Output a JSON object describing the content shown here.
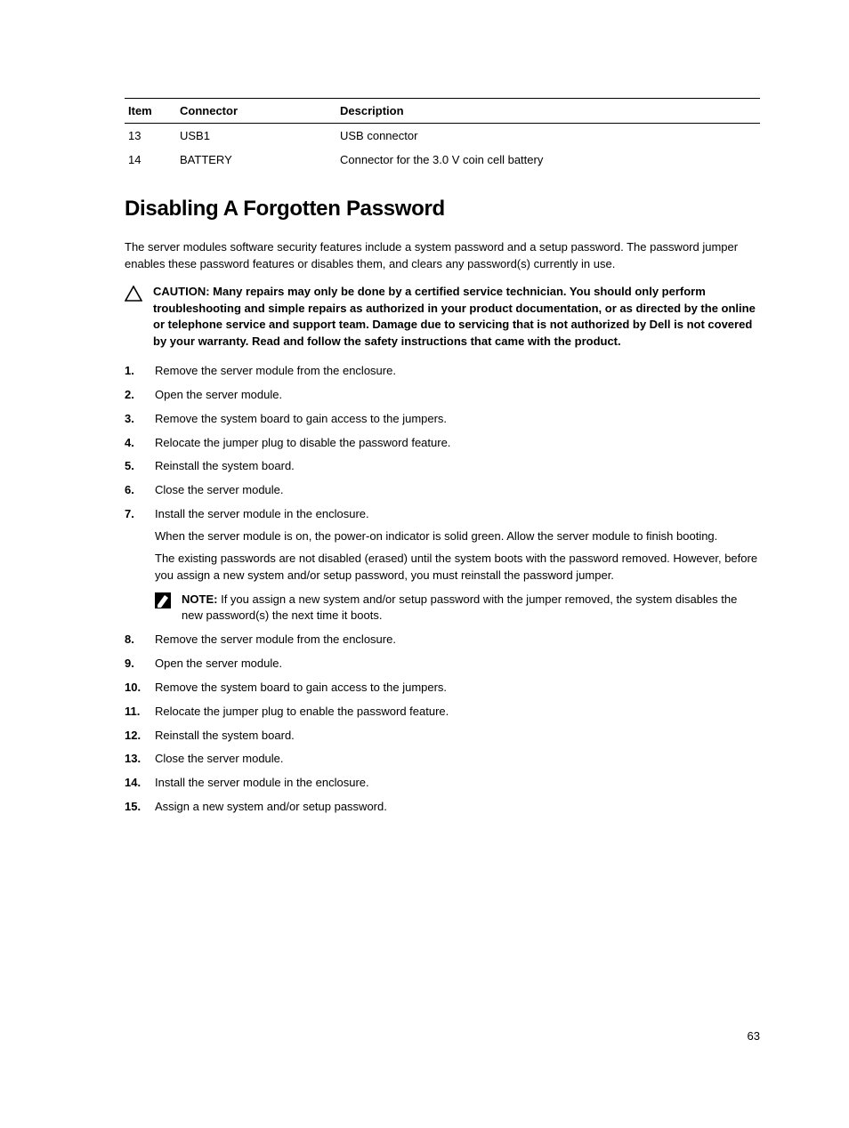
{
  "table": {
    "headers": {
      "item": "Item",
      "connector": "Connector",
      "description": "Description"
    },
    "rows": [
      {
        "item": "13",
        "connector": "USB1",
        "description": "USB connector"
      },
      {
        "item": "14",
        "connector": "BATTERY",
        "description": "Connector for the 3.0 V coin cell battery"
      }
    ]
  },
  "section_title": "Disabling A Forgotten Password",
  "intro": "The server modules software security features include a system password and a setup password. The password jumper enables these password features or disables them, and clears any password(s) currently in use.",
  "caution": {
    "label": "CAUTION:",
    "text": "Many repairs may only be done by a certified service technician. You should only perform troubleshooting and simple repairs as authorized in your product documentation, or as directed by the online or telephone service and support team. Damage due to servicing that is not authorized by Dell is not covered by your warranty. Read and follow the safety instructions that came with the product."
  },
  "steps": {
    "s1": "Remove the server module from the enclosure.",
    "s2": "Open the server module.",
    "s3": "Remove the system board to gain access to the jumpers.",
    "s4": "Relocate the jumper plug to disable the password feature.",
    "s5": "Reinstall the system board.",
    "s6": "Close the server module.",
    "s7": "Install the server module in the enclosure.",
    "s7p1": "When the server module is on, the power-on indicator is solid green. Allow the server module to finish booting.",
    "s7p2": "The existing passwords are not disabled (erased) until the system boots with the password removed. However, before you assign a new system and/or setup password, you must reinstall the password jumper.",
    "s7note_label": "NOTE:",
    "s7note": "If you assign a new system and/or setup password with the jumper removed, the system disables the new password(s) the next time it boots.",
    "s8": "Remove the server module from the enclosure.",
    "s9": "Open the server module.",
    "s10": "Remove the system board to gain access to the jumpers.",
    "s11": "Relocate the jumper plug to enable the password feature.",
    "s12": "Reinstall the system board.",
    "s13": "Close the server module.",
    "s14": "Install the server module in the enclosure.",
    "s15": "Assign a new system and/or setup password."
  },
  "page_number": "63"
}
